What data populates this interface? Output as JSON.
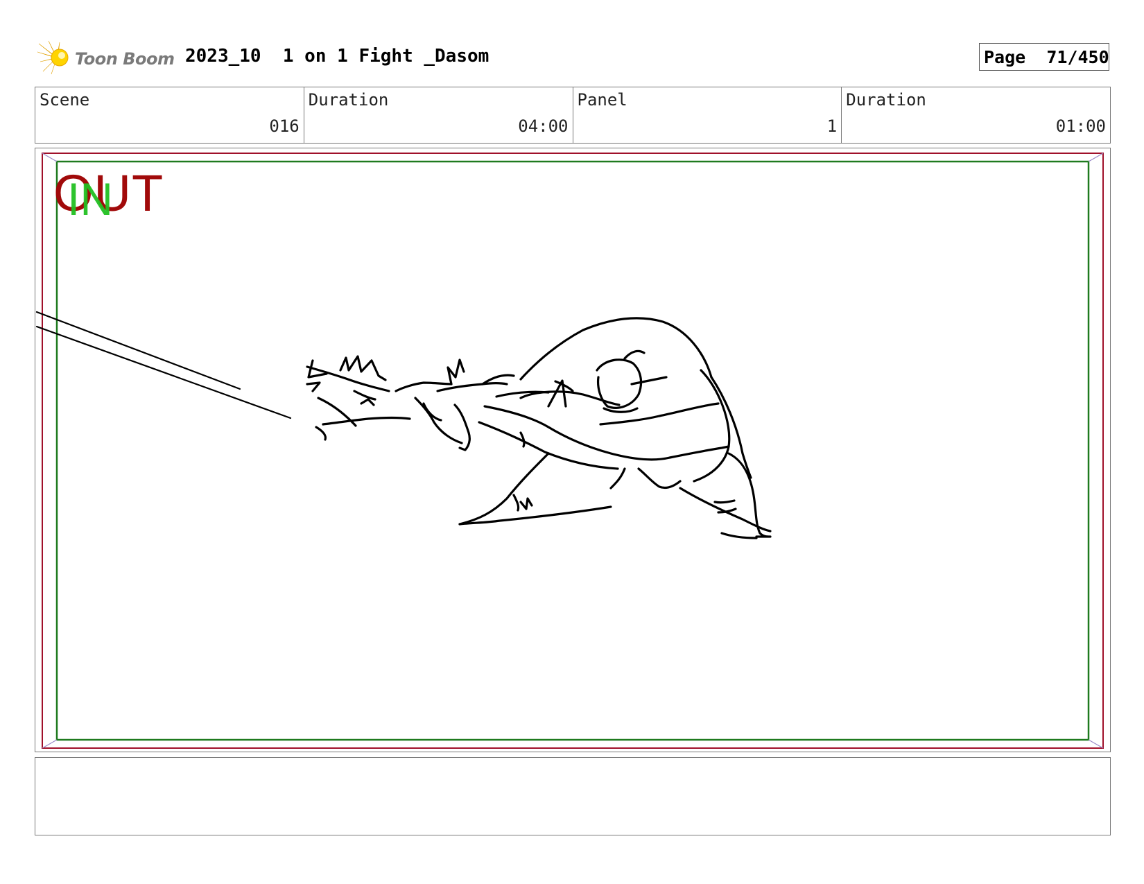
{
  "header": {
    "logo_text": "Toon Boom",
    "project_title": "2023_10  1 on 1 Fight _Dasom",
    "page_label": "Page",
    "page_number": "71/450"
  },
  "info": {
    "scene_label": "Scene",
    "scene_value": "016",
    "scene_duration_label": "Duration",
    "scene_duration_value": "04:00",
    "panel_label": "Panel",
    "panel_value": "1",
    "panel_duration_label": "Duration",
    "panel_duration_value": "01:00"
  },
  "panel": {
    "out_marker": "OUT",
    "in_marker": "IN",
    "colors": {
      "safe_frame_red": "#a0102a",
      "safe_frame_green": "#1e7a1e",
      "out_text": "#a10a0a",
      "in_text": "#22c022"
    }
  },
  "notes": {
    "text": ""
  }
}
